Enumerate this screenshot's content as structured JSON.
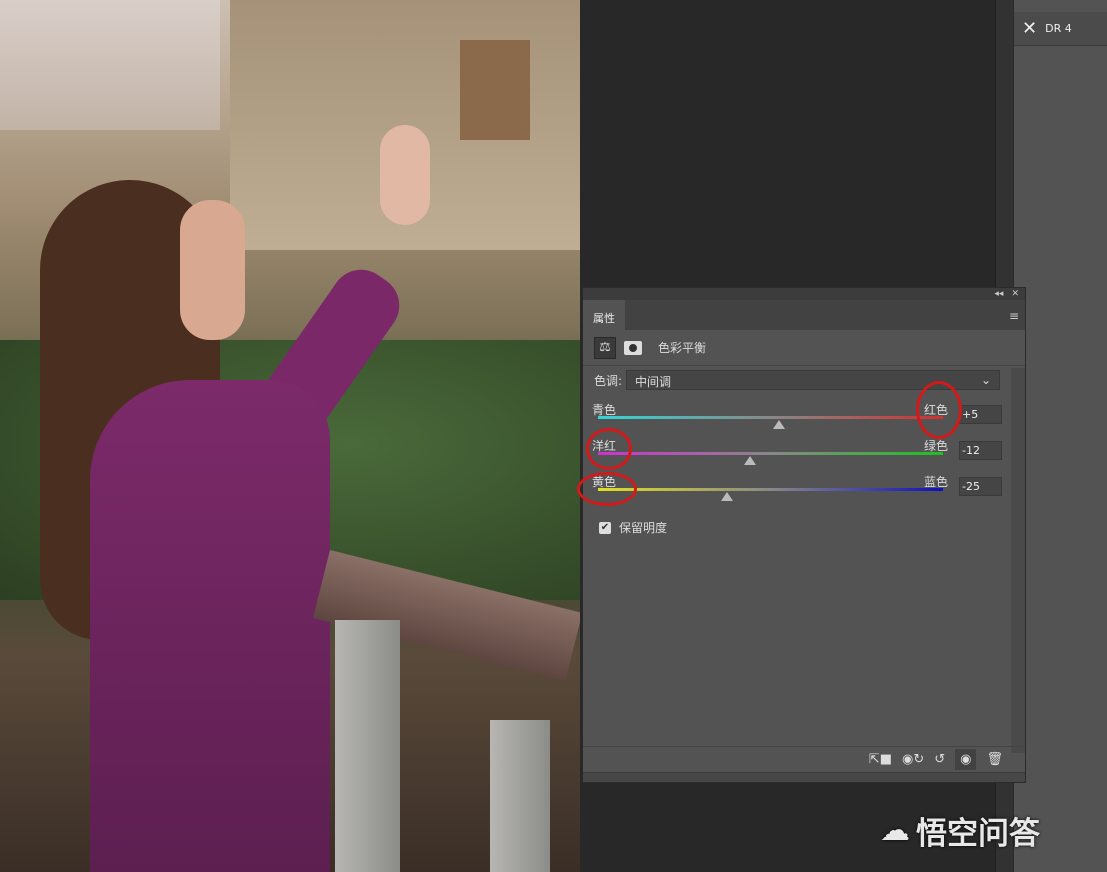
{
  "right_panel": {
    "item_label": "DR 4",
    "item_icon": "brushes-icon"
  },
  "properties": {
    "tab": "属性",
    "adjustment_title": "色彩平衡",
    "tone_label": "色调:",
    "tone_value": "中间调",
    "sliders": [
      {
        "left": "青色",
        "right": "红色",
        "value": "+5",
        "numeric": 5,
        "left_color": "#2fd6d6",
        "right_color": "#d03030"
      },
      {
        "left": "洋红",
        "right": "绿色",
        "value": "-12",
        "numeric": -12,
        "left_color": "#d030d0",
        "right_color": "#20c020"
      },
      {
        "left": "黄色",
        "right": "蓝色",
        "value": "-25",
        "numeric": -25,
        "left_color": "#e0e020",
        "right_color": "#1010c0"
      }
    ],
    "slider_range": [
      -100,
      100
    ],
    "preserve_luminosity": {
      "label": "保留明度",
      "checked": true
    }
  },
  "watermark": "悟空问答"
}
